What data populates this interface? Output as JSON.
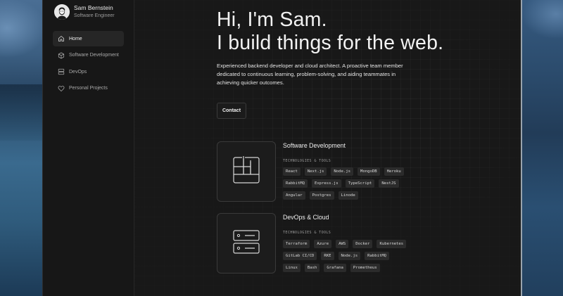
{
  "profile": {
    "name": "Sam Bernstein",
    "role": "Software Engineer"
  },
  "nav": [
    {
      "label": "Home",
      "icon": "home-icon",
      "active": true
    },
    {
      "label": "Software Development",
      "icon": "cube-icon",
      "active": false
    },
    {
      "label": "DevOps",
      "icon": "server-icon",
      "active": false
    },
    {
      "label": "Personal Projects",
      "icon": "heart-icon",
      "active": false
    }
  ],
  "hero": {
    "line1": "Hi, I'm Sam.",
    "line2": "I build things for the web."
  },
  "intro": "Experienced backend developer and cloud architect. A proactive team member dedicated to continuous learning, problem-solving, and aiding teammates in achieving quicker outcomes.",
  "contact_label": "Contact",
  "sections": [
    {
      "title": "Software Development",
      "icon": "grid-layout-icon",
      "tools_label": "TECHNOLOGIES & TOOLS",
      "rows": [
        [
          "React",
          "Next.js",
          "Node.js",
          "MongoDB",
          "Heroku"
        ],
        [
          "RabbitMQ",
          "Express.js",
          "TypeScript",
          "NestJS"
        ],
        [
          "Angular",
          "Postgres",
          "Linode"
        ]
      ]
    },
    {
      "title": "DevOps & Cloud",
      "icon": "server-rack-icon",
      "tools_label": "TECHNOLOGIES & TOOLS",
      "rows": [
        [
          "Terraform",
          "Azure",
          "AWS",
          "Docker",
          "Kubernetes"
        ],
        [
          "GitLab CI/CD",
          "RKE",
          "Node.js",
          "RabbitMQ"
        ],
        [
          "Linux",
          "Bash",
          "Grafana",
          "Prometheus"
        ]
      ]
    }
  ]
}
